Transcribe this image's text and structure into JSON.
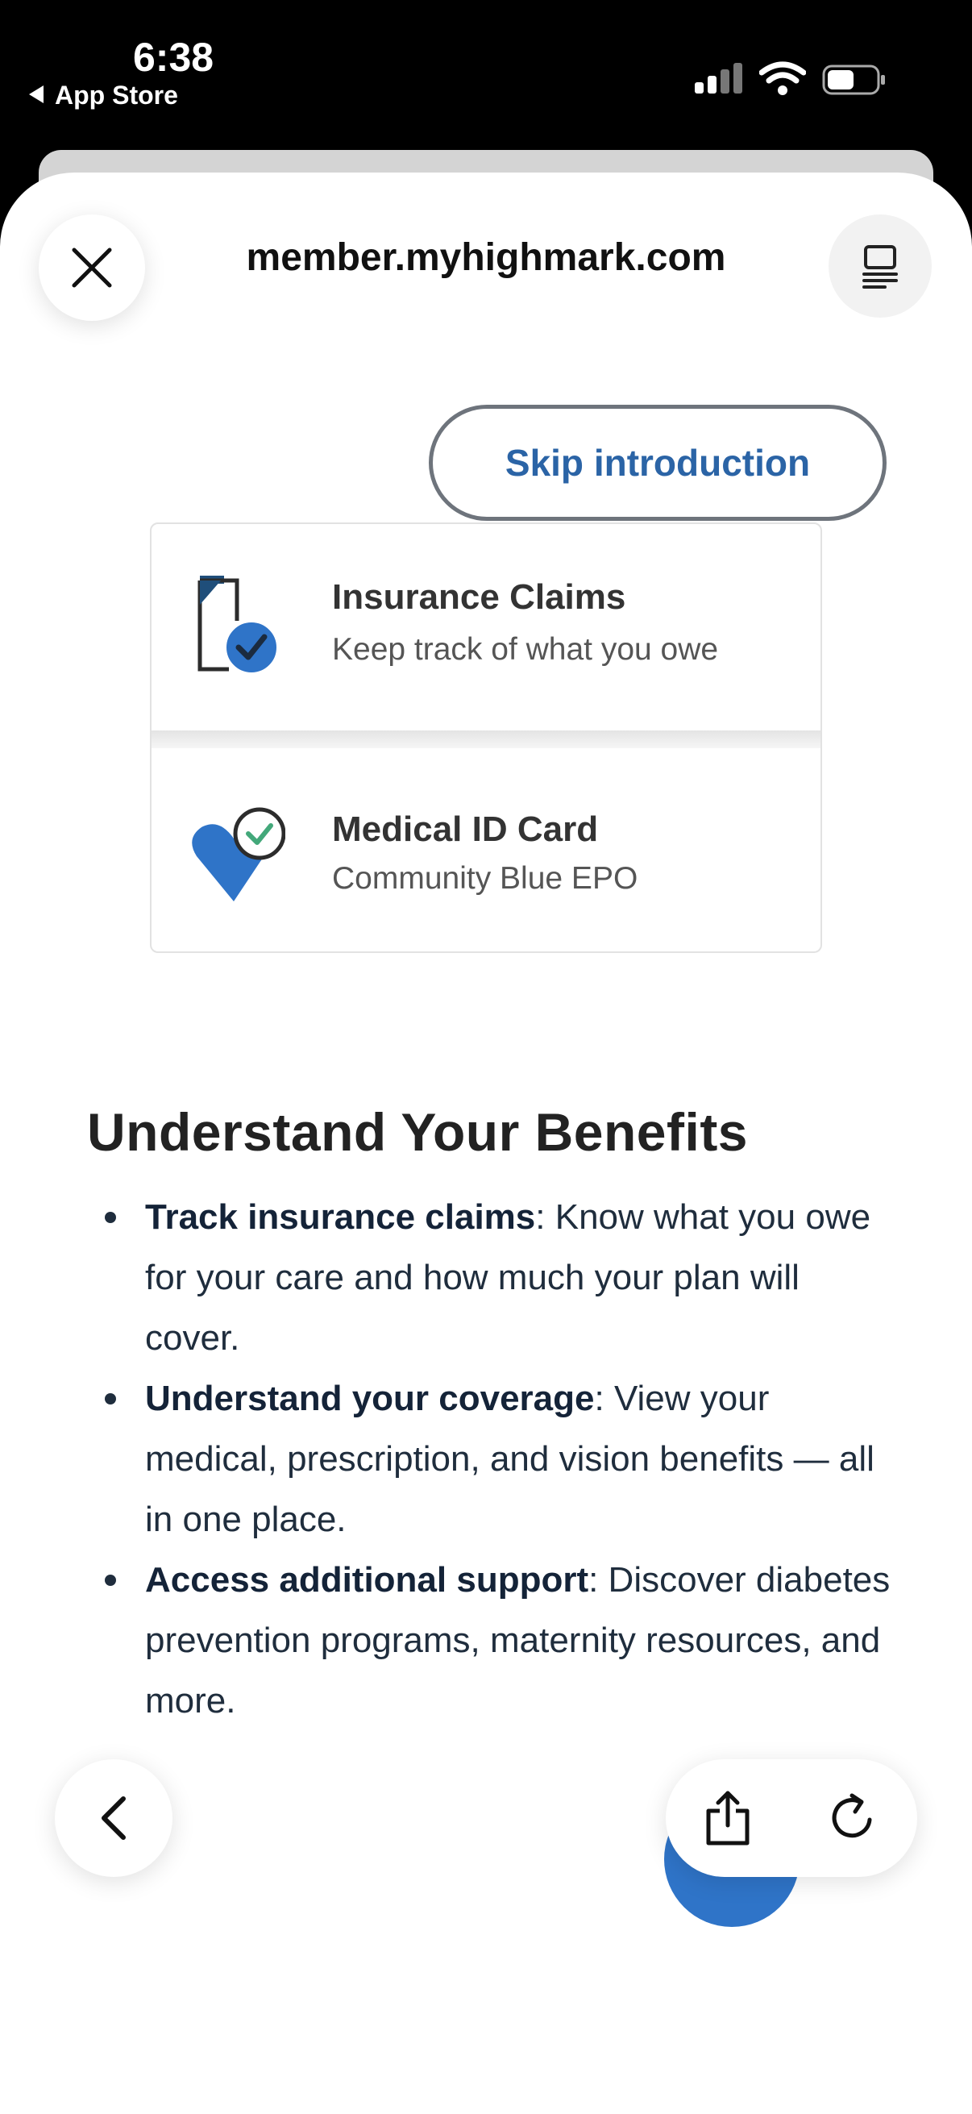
{
  "status_bar": {
    "time": "6:38",
    "back_app": "App Store"
  },
  "browser": {
    "url": "member.myhighmark.com",
    "close_icon": "close-icon",
    "reader_icon": "reader-mode-icon"
  },
  "intro": {
    "skip_label": "Skip introduction",
    "cards": [
      {
        "title": "Insurance Claims",
        "subtitle": "Keep track of what you owe",
        "icon": "claims-document-icon"
      },
      {
        "title": "Medical ID Card",
        "subtitle": "Community Blue EPO",
        "icon": "heart-check-icon"
      }
    ],
    "heading": "Understand Your Benefits",
    "bullets": [
      {
        "bold": "Track insurance claims",
        "text": ": Know what you owe for your care and how much your plan will cover."
      },
      {
        "bold": "Understand your coverage",
        "text": ": View your medical, prescription, and vision benefits — all in one place."
      },
      {
        "bold": "Access additional support",
        "text": ": Discover diabetes prevention programs, maternity resources, and more."
      }
    ],
    "next_icon": "arrow-right-icon"
  },
  "toolbar": {
    "back_icon": "chevron-left-icon",
    "share_icon": "share-icon",
    "reload_icon": "reload-icon"
  },
  "colors": {
    "accent_blue": "#2f74c8",
    "skip_text": "#2b64a6",
    "text_dark": "#1f2d3d"
  }
}
